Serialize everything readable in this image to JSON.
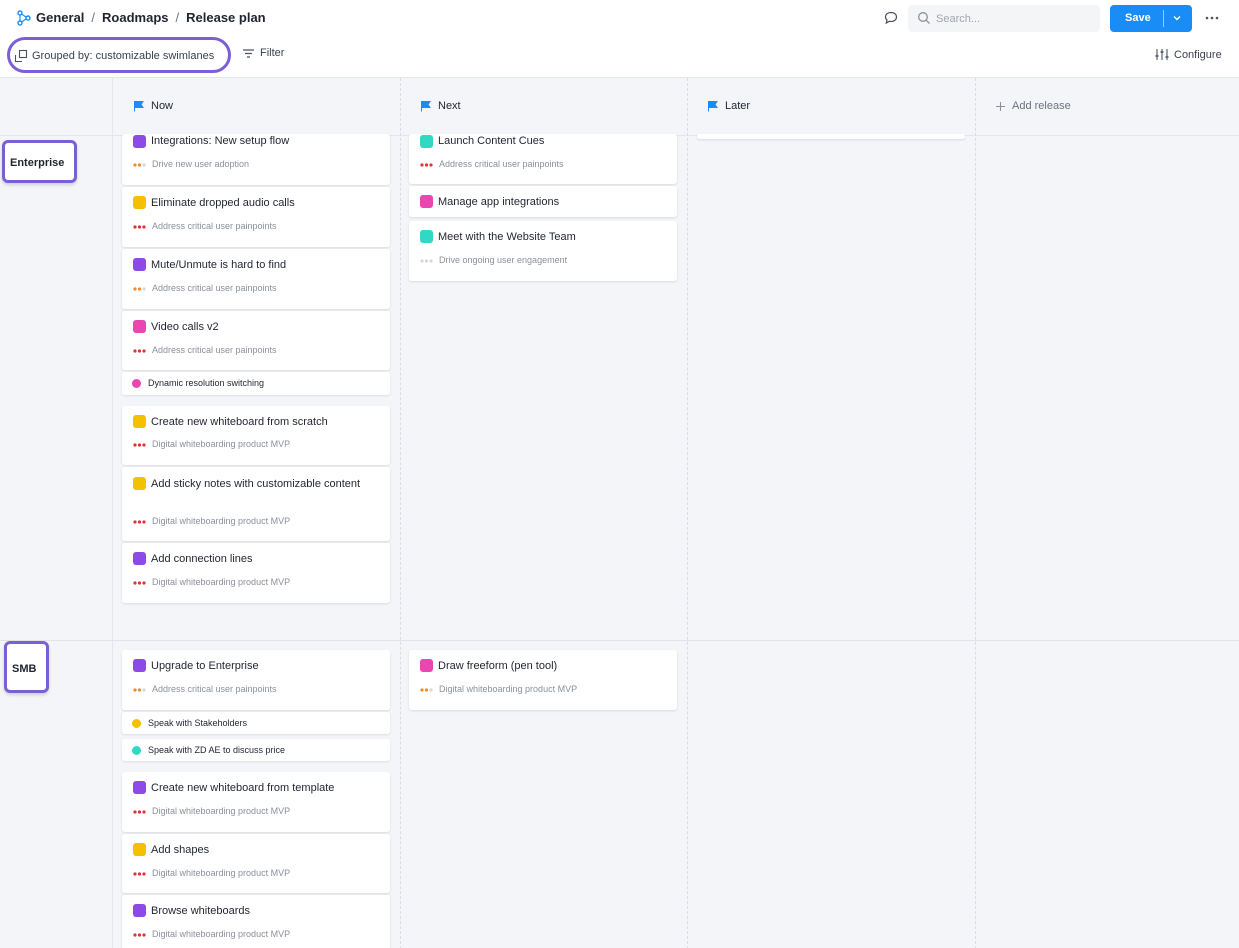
{
  "breadcrumb": {
    "items": [
      "General",
      "Roadmaps",
      "Release plan"
    ],
    "separator": "/"
  },
  "search": {
    "placeholder": "Search..."
  },
  "toolbar": {
    "save_label": "Save",
    "grouped_by_label": "Grouped by: customizable swimlanes",
    "filter_label": "Filter",
    "configure_label": "Configure"
  },
  "columns": [
    {
      "label": "Now"
    },
    {
      "label": "Next"
    },
    {
      "label": "Later"
    }
  ],
  "add_release_label": "Add release",
  "colors": {
    "accent": "#1a8cf5",
    "highlight": "#7b5fd6",
    "purple": "#8e4ae6",
    "yellow": "#f5c000",
    "pink": "#ea46b0",
    "teal": "#2fd9c4",
    "red": "#e03333",
    "orange": "#f08a2e"
  },
  "lanes": [
    {
      "label": "Enterprise",
      "now": [
        {
          "title": "Integrations: New setup flow",
          "goal": "Drive new user adoption"
        },
        {
          "title": "Eliminate dropped audio calls",
          "goal": "Address critical user painpoints"
        },
        {
          "title": "Mute/Unmute is hard to find",
          "goal": "Address critical user painpoints"
        },
        {
          "title": "Video calls v2",
          "goal": "Address critical user painpoints"
        },
        {
          "title": "Dynamic resolution switching"
        },
        {
          "title": "Create new whiteboard from scratch",
          "goal": "Digital whiteboarding product MVP"
        },
        {
          "title": "Add sticky notes with customizable content",
          "goal": "Digital whiteboarding product MVP"
        },
        {
          "title": "Add connection lines",
          "goal": "Digital whiteboarding product MVP"
        }
      ],
      "next": [
        {
          "title": "Launch Content Cues",
          "goal": "Address critical user painpoints"
        },
        {
          "title": "Manage app integrations"
        },
        {
          "title": "Meet with the Website Team",
          "goal": "Drive ongoing user engagement"
        }
      ]
    },
    {
      "label": "SMB",
      "now": [
        {
          "title": "Upgrade to Enterprise",
          "goal": "Address critical user painpoints"
        },
        {
          "title": "Speak with Stakeholders"
        },
        {
          "title": "Speak with ZD AE to discuss price"
        },
        {
          "title": "Create new whiteboard from template",
          "goal": "Digital whiteboarding product MVP"
        },
        {
          "title": "Add shapes",
          "goal": "Digital whiteboarding product MVP"
        },
        {
          "title": "Browse whiteboards",
          "goal": "Digital whiteboarding product MVP"
        }
      ],
      "next": [
        {
          "title": "Draw freeform (pen tool)",
          "goal": "Digital whiteboarding product MVP"
        }
      ]
    }
  ]
}
